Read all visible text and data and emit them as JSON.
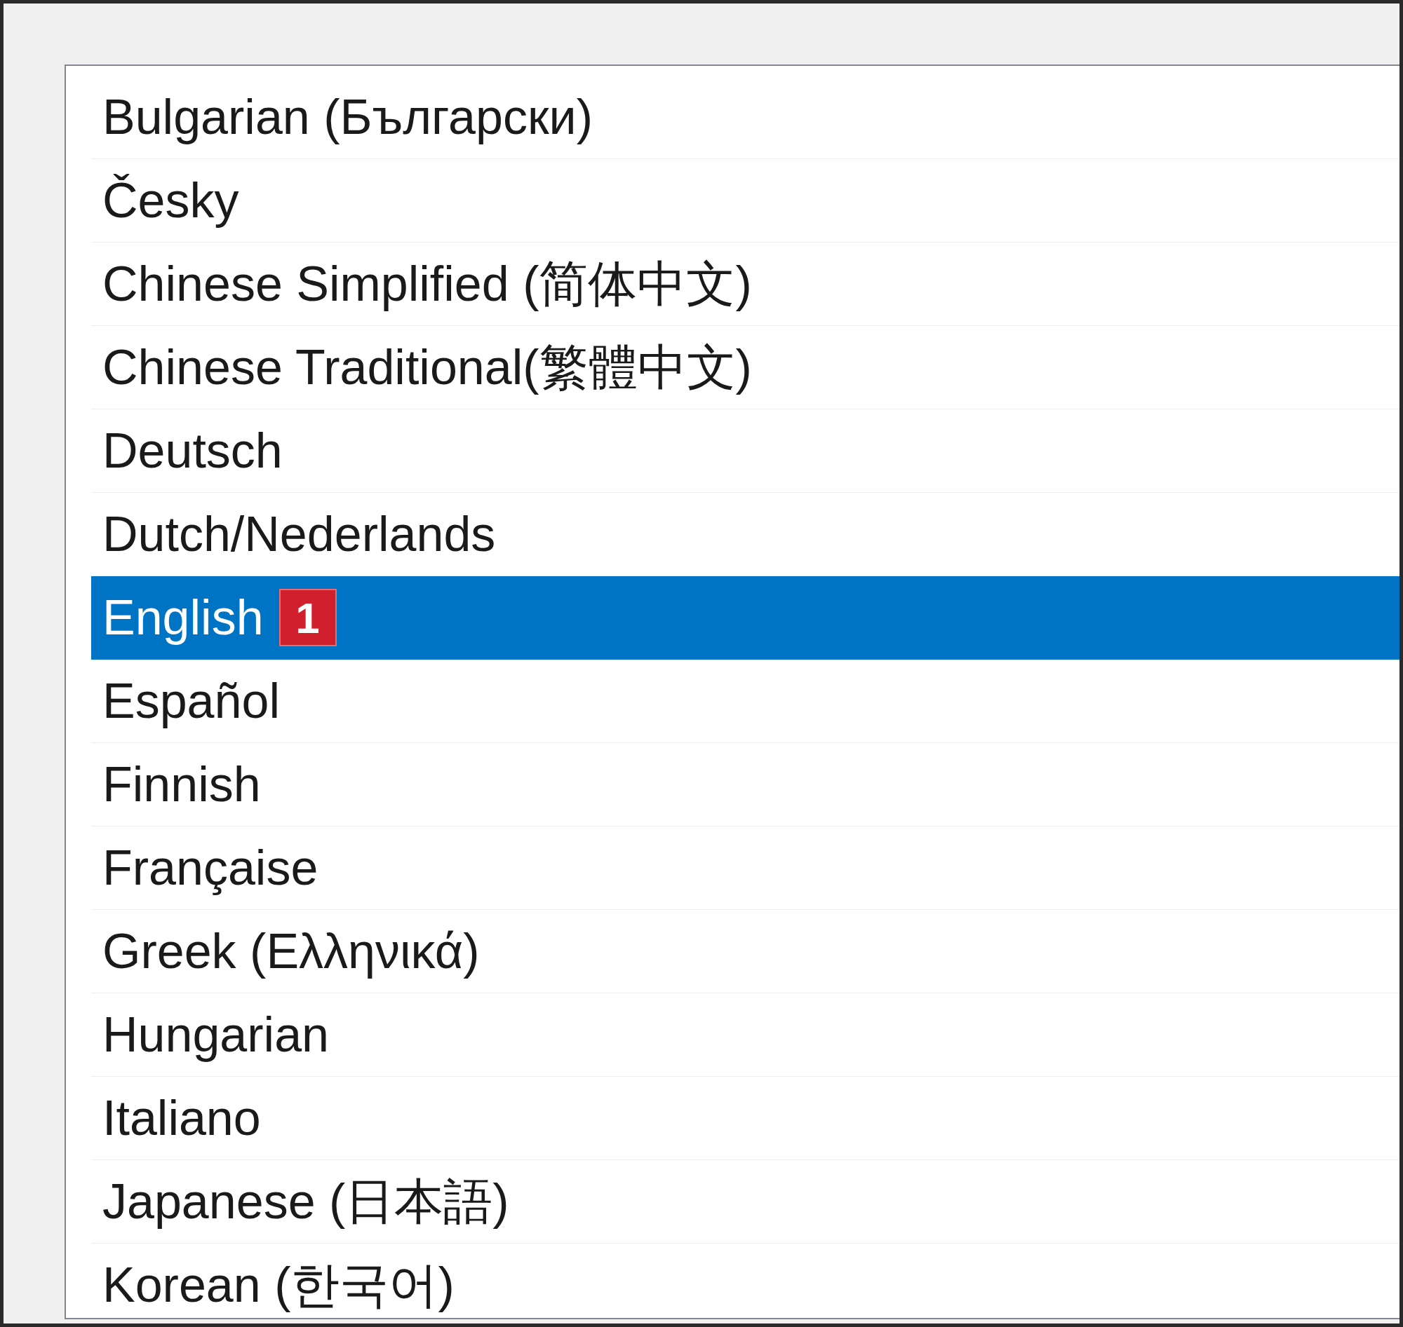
{
  "language_list": [
    {
      "label": "Bulgarian (Български)",
      "selected": false
    },
    {
      "label": "Česky",
      "selected": false
    },
    {
      "label": "Chinese Simplified (简体中文)",
      "selected": false
    },
    {
      "label": "Chinese Traditional(繁體中文)",
      "selected": false
    },
    {
      "label": "Deutsch",
      "selected": false
    },
    {
      "label": "Dutch/Nederlands",
      "selected": false
    },
    {
      "label": "English",
      "selected": true,
      "badge": "1"
    },
    {
      "label": "Español",
      "selected": false
    },
    {
      "label": "Finnish",
      "selected": false
    },
    {
      "label": "Française",
      "selected": false
    },
    {
      "label": "Greek (Ελληνικά)",
      "selected": false
    },
    {
      "label": "Hungarian",
      "selected": false
    },
    {
      "label": "Italiano",
      "selected": false
    },
    {
      "label": "Japanese (日本語)",
      "selected": false
    },
    {
      "label": "Korean (한국어)",
      "selected": false
    }
  ]
}
